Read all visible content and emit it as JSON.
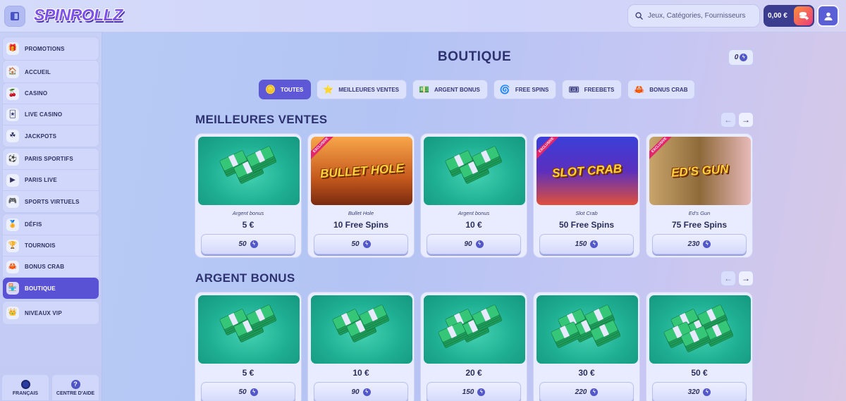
{
  "header": {
    "logo": "SPINROLLZ",
    "search_placeholder": "Jeux, Catégories, Fournisseurs",
    "balance": "0,00 €"
  },
  "sidebar": {
    "groups": [
      [
        {
          "label": "PROMOTIONS",
          "icon": "gift-icon",
          "glyph": "🎁"
        }
      ],
      [
        {
          "label": "ACCUEIL",
          "icon": "home-icon",
          "glyph": "🏠"
        }
      ],
      [
        {
          "label": "CASINO",
          "icon": "cherries-icon",
          "glyph": "🍒"
        },
        {
          "label": "LIVE CASINO",
          "icon": "cards-icon",
          "glyph": "🃏"
        },
        {
          "label": "JACKPOTS",
          "icon": "clover-icon",
          "glyph": "☘"
        }
      ],
      [
        {
          "label": "PARIS SPORTIFS",
          "icon": "ball-icon",
          "glyph": "⚽"
        },
        {
          "label": "PARIS LIVE",
          "icon": "live-icon",
          "glyph": "▶"
        },
        {
          "label": "SPORTS VIRTUELS",
          "icon": "gamepad-icon",
          "glyph": "🎮"
        }
      ],
      [
        {
          "label": "DÉFIS",
          "icon": "medal-icon",
          "glyph": "🏅"
        },
        {
          "label": "TOURNOIS",
          "icon": "trophy-icon",
          "glyph": "🏆"
        },
        {
          "label": "BONUS CRAB",
          "icon": "crab-claw-icon",
          "glyph": "🦀"
        },
        {
          "label": "BOUTIQUE",
          "icon": "shop-icon",
          "glyph": "🏪",
          "active": true
        }
      ],
      [
        {
          "label": "NIVEAUX VIP",
          "icon": "crown-icon",
          "glyph": "👑"
        }
      ]
    ],
    "language": "FRANÇAIS",
    "help": "CENTRE D'AIDE"
  },
  "main": {
    "title": "BOUTIQUE",
    "coin_count": "0",
    "filters": [
      {
        "label": "TOUTES",
        "icon": "coins-icon",
        "glyph": "🪙",
        "active": true
      },
      {
        "label": "MEILLEURES VENTES",
        "icon": "star-icon",
        "glyph": "⭐"
      },
      {
        "label": "ARGENT BONUS",
        "icon": "cash-icon",
        "glyph": "💵"
      },
      {
        "label": "FREE SPINS",
        "icon": "spin-icon",
        "glyph": "🌀"
      },
      {
        "label": "FREEBETS",
        "icon": "ticket-icon",
        "glyph": "🎟"
      },
      {
        "label": "BONUS CRAB",
        "icon": "crab-icon",
        "glyph": "🦀"
      }
    ],
    "sections": [
      {
        "title": "MEILLEURES VENTES",
        "items": [
          {
            "type": "cash",
            "meta": "Argent bonus",
            "title": "5 €",
            "price": "50"
          },
          {
            "type": "game",
            "meta": "Bullet Hole",
            "title": "10 Free Spins",
            "price": "50",
            "game_name": "BULLET HOLE",
            "exclusive": "EXCLUSIVE",
            "bg": "linear-gradient(180deg,#f7a64a,#c65a1d 60%,#7a2a10)"
          },
          {
            "type": "cash",
            "meta": "Argent bonus",
            "title": "10 €",
            "price": "90"
          },
          {
            "type": "game",
            "meta": "Slot Crab",
            "title": "50 Free Spins",
            "price": "150",
            "game_name": "SLOT CRAB",
            "exclusive": "EXCLUSIVE",
            "bg": "linear-gradient(180deg,#3a3fd8,#5b2fbf 50%,#e0503a)"
          },
          {
            "type": "game",
            "meta": "Ed's Gun",
            "title": "75 Free Spins",
            "price": "230",
            "game_name": "ED'S GUN",
            "exclusive": "EXCLUSIVE",
            "bg": "linear-gradient(90deg,#c9a56b,#8e6a3a 50%,#e8b9b9)"
          }
        ]
      },
      {
        "title": "ARGENT BONUS",
        "items": [
          {
            "type": "cash",
            "meta": "",
            "title": "5 €",
            "price": "50"
          },
          {
            "type": "cash",
            "meta": "",
            "title": "10 €",
            "price": "90"
          },
          {
            "type": "cash",
            "meta": "",
            "title": "20 €",
            "price": "150"
          },
          {
            "type": "cash",
            "meta": "",
            "title": "30 €",
            "price": "220"
          },
          {
            "type": "cash",
            "meta": "",
            "title": "50 €",
            "price": "320"
          }
        ]
      }
    ]
  }
}
